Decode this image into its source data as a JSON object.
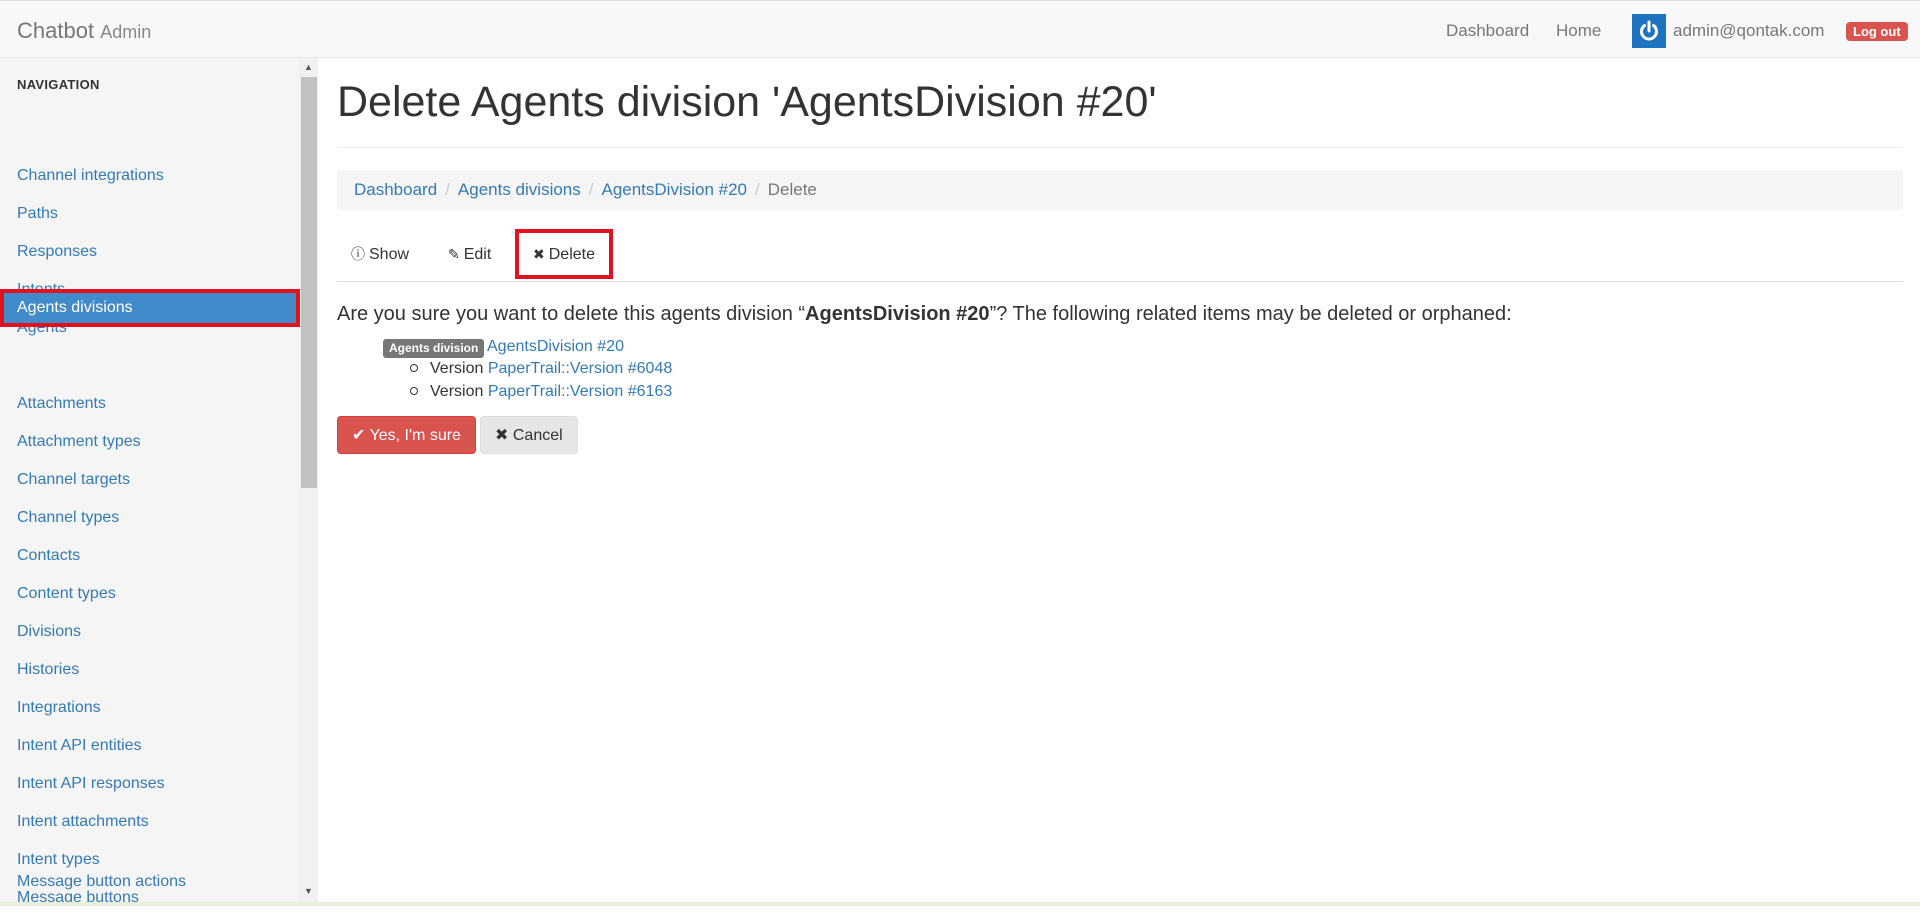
{
  "navbar": {
    "brand": "Chatbot",
    "brand_sub": "Admin",
    "links": [
      "Dashboard",
      "Home"
    ],
    "user_email": "admin@qontak.com",
    "logout_label": "Log out"
  },
  "sidebar": {
    "header": "NAVIGATION",
    "items": [
      {
        "label": "Channel integrations"
      },
      {
        "label": "Paths"
      },
      {
        "label": "Responses"
      },
      {
        "label": "Intents"
      },
      {
        "label": "Agents"
      },
      {
        "label": "Agents divisions",
        "active": true
      },
      {
        "label": "Attachments"
      },
      {
        "label": "Attachment types"
      },
      {
        "label": "Channel targets"
      },
      {
        "label": "Channel types"
      },
      {
        "label": "Contacts"
      },
      {
        "label": "Content types"
      },
      {
        "label": "Divisions"
      },
      {
        "label": "Histories"
      },
      {
        "label": "Integrations"
      },
      {
        "label": "Intent API entities"
      },
      {
        "label": "Intent API responses"
      },
      {
        "label": "Intent attachments"
      },
      {
        "label": "Intent types"
      },
      {
        "label": "Message buttons"
      },
      {
        "label": "Message button actions"
      }
    ]
  },
  "main": {
    "title": "Delete Agents division 'AgentsDivision #20'",
    "breadcrumb": [
      "Dashboard",
      "Agents divisions",
      "AgentsDivision #20"
    ],
    "breadcrumb_current": "Delete",
    "tabs": [
      {
        "label": "Show",
        "icon": "info-circle-icon"
      },
      {
        "label": "Edit",
        "icon": "pencil-icon"
      },
      {
        "label": "Delete",
        "icon": "times-icon",
        "active": true
      }
    ],
    "confirm_prefix": "Are you sure you want to delete this agents division “",
    "confirm_name": "AgentsDivision #20",
    "confirm_suffix": "”? The following related items may be deleted or orphaned:",
    "related_label": "Agents division",
    "related_link": "AgentsDivision #20",
    "versions": [
      {
        "prefix": "Version",
        "link": "PaperTrail::Version #6048"
      },
      {
        "prefix": "Version",
        "link": "PaperTrail::Version #6163"
      }
    ],
    "confirm_button": "Yes, I'm sure",
    "cancel_button": "Cancel"
  },
  "colors": {
    "link": "#337ab7",
    "active_nav": "#428bca",
    "danger": "#d9534f",
    "highlight_box": "#e1121f"
  }
}
